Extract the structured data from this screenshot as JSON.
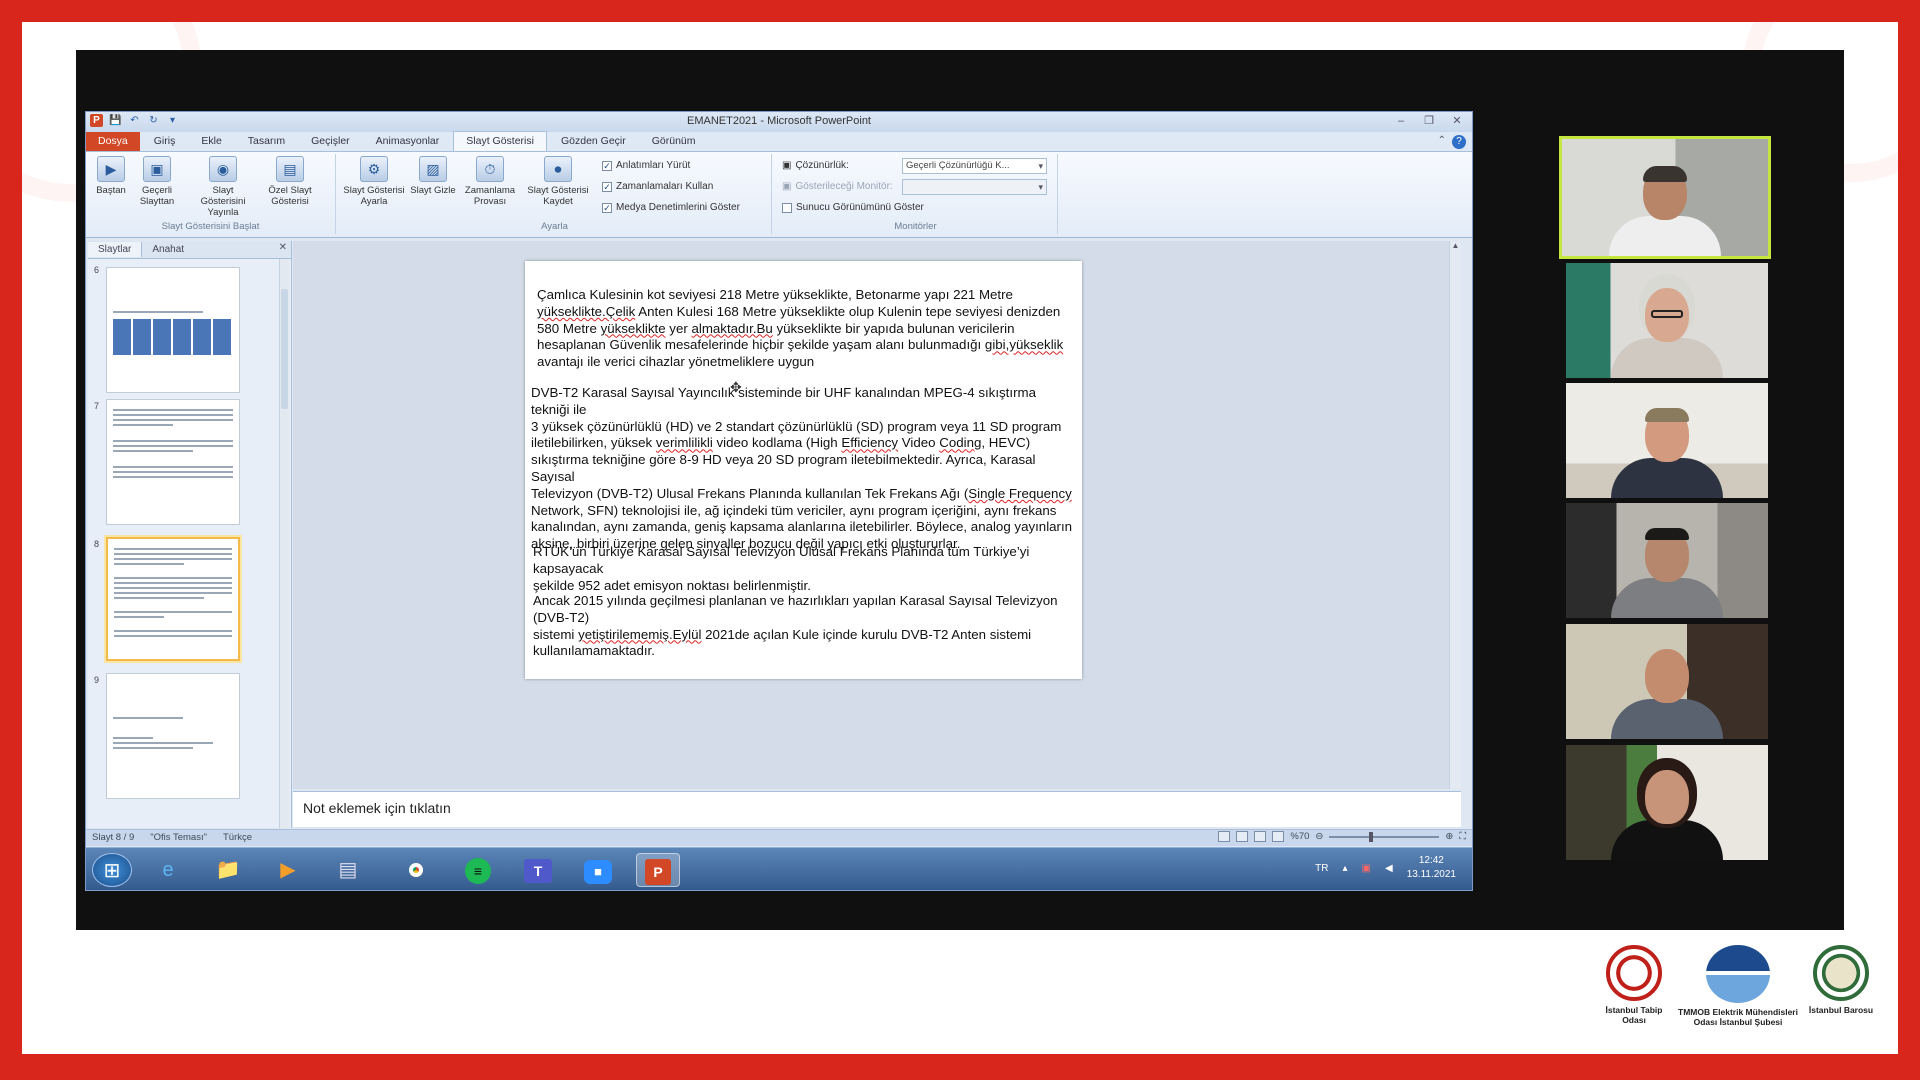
{
  "window": {
    "title": "EMANET2021 - Microsoft PowerPoint"
  },
  "ribbon_tabs": [
    "Dosya",
    "Giriş",
    "Ekle",
    "Tasarım",
    "Geçişler",
    "Animasyonlar",
    "Slayt Gösterisi",
    "Gözden Geçir",
    "Görünüm"
  ],
  "ribbon": {
    "buttons": [
      {
        "label": "Baştan",
        "icon": "play-slideshow-icon"
      },
      {
        "label": "Geçerli Slayttan",
        "icon": "current-slide-icon"
      },
      {
        "label": "Slayt Gösterisini Yayınla",
        "icon": "broadcast-icon"
      },
      {
        "label": "Özel Slayt Gösterisi",
        "icon": "custom-show-icon"
      },
      {
        "label": "Slayt Gösterisi Ayarla",
        "icon": "setup-show-icon"
      },
      {
        "label": "Slayt Gizle",
        "icon": "hide-slide-icon"
      },
      {
        "label": "Zamanlama Provası",
        "icon": "rehearse-timings-icon"
      },
      {
        "label": "Slayt Gösterisi Kaydet",
        "icon": "record-show-icon"
      }
    ],
    "groups": {
      "start": "Slayt Gösterisini Başlat",
      "setup": "Ayarla",
      "monitors": "Monitörler"
    },
    "checkboxes": [
      {
        "label": "Anlatımları Yürüt",
        "checked": true
      },
      {
        "label": "Zamanlamaları Kullan",
        "checked": true
      },
      {
        "label": "Medya Denetimlerini Göster",
        "checked": true
      }
    ],
    "resolution_label": "Çözünürlük:",
    "resolution_value": "Geçerli Çözünürlüğü K...",
    "show_on_label": "Gösterileceği Monitör:",
    "presenter_view_label": "Sunucu Görünümünü Göster"
  },
  "pane": {
    "tab_slides": "Slaytlar",
    "tab_outline": "Anahat",
    "slide_numbers": [
      "6",
      "7",
      "8",
      "9"
    ]
  },
  "slide": {
    "p1": [
      "Çamlıca Kulesinin kot seviyesi 218 Metre yükseklikte, Betonarme yapı 221 Metre",
      "yükseklikte.Çelik",
      " Anten Kulesi 168 Metre yükseklikte olup Kulenin tepe seviyesi denizden",
      "580 Metre ",
      "yükseklikte",
      " yer ",
      "almaktadır.Bu",
      " yükseklikte bir yapıda bulunan vericilerin",
      "hesaplanan Güvenlik mesafelerinde hiçbir şekilde yaşam alanı bulunmadığı ",
      "gibi,yükseklik",
      "avantajı ile verici cihazlar yönetmeliklere uygun"
    ],
    "p2": [
      "DVB-T2 Karasal Sayısal Yayıncılık sisteminde bir UHF kanalından MPEG-4 sıkıştırma  tekniği ile",
      "3 yüksek çözünürlüklü (HD)  ve 2 standart çözünürlüklü (SD) program veya 11 SD program",
      "iletilebilirken, yüksek ",
      "verimlilikli",
      " video kodlama (High ",
      "Efficiency",
      " Video ",
      "Coding",
      ",  HEVC)",
      "sıkıştırma  tekniğine  göre 8-9 HD veya 20 SD program iletebilmektedir. Ayrıca, Karasal Sayısal",
      "Televizyon (DVB-T2) Ulusal Frekans Planında kullanılan Tek Frekans Ağı (",
      "Single Frequency",
      "Network, SFN) teknolojisi ile, ağ içindeki tüm vericiler, aynı  program  içeriğini,  aynı  frekans",
      "kanalından, aynı zamanda, geniş kapsama alanlarına iletebilirler. Böylece, analog yayınların",
      "aksine, birbiri üzerine gelen sinyaller bozucu değil yapıcı etki oluştururlar."
    ],
    "p3": [
      "RTÜK’ün Türkiye Karasal Sayısal Televizyon Ulusal Frekans Planında tüm Türkiye’yi kapsayacak",
      "şekilde 952 adet emisyon noktası belirlenmiştir."
    ],
    "p4": [
      "Ancak 2015 yılında geçilmesi planlanan ve hazırlıkları yapılan Karasal Sayısal Televizyon (DVB-T2)",
      "sistemi ",
      "yetiştirilememiş.Eylül",
      " 2021de açılan Kule içinde kurulu DVB-T2 Anten sistemi",
      "kullanılamamaktadır."
    ]
  },
  "notes_placeholder": "Not eklemek için tıklatın",
  "status": {
    "slide": "Slayt 8 / 9",
    "theme": "\"Ofis Teması\"",
    "language": "Türkçe",
    "zoom": "%70"
  },
  "taskbar": {
    "apps": [
      "windows-start-icon",
      "internet-explorer-icon",
      "file-explorer-icon",
      "media-player-icon",
      "notepad-icon",
      "chrome-icon",
      "spotify-icon",
      "teams-icon",
      "zoom-icon",
      "powerpoint-icon"
    ],
    "tray_lang": "TR",
    "time": "12:42",
    "date": "13.11.2021"
  },
  "participants": 6,
  "logos": [
    {
      "name": "İstanbul Tabip Odası"
    },
    {
      "name": "TMMOB Elektrik Mühendisleri Odası İstanbul Şubesi"
    },
    {
      "name": "İstanbul Barosu"
    }
  ],
  "colors": {
    "frame": "#d9261c",
    "speaker_highlight": "#c4e63e",
    "ppt_accent": "#d24726"
  }
}
